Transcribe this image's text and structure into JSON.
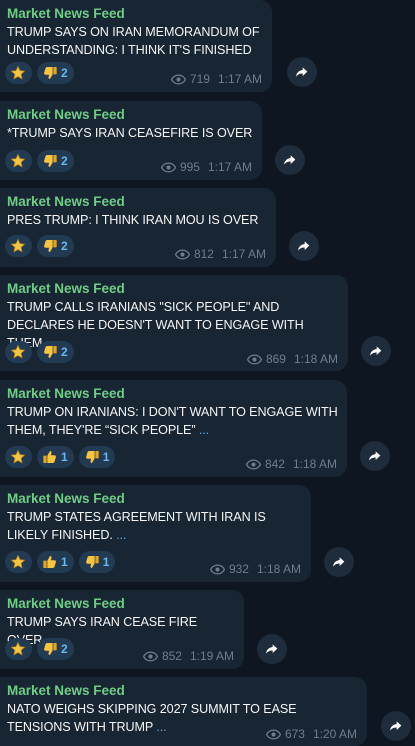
{
  "messages": [
    {
      "sender": "Market News Feed",
      "text": "TRUMP SAYS ON IRAN MEMORANDUM OF UNDERSTANDING: I THINK IT'S FINISHED",
      "more": "...",
      "reactions": [
        {
          "icon": "star-icon",
          "count": ""
        },
        {
          "icon": "thumbs-down-icon",
          "count": "2"
        }
      ],
      "views": "719",
      "time": "1:17 AM"
    },
    {
      "sender": "Market News Feed",
      "text": "*TRUMP SAYS IRAN CEASEFIRE IS OVER",
      "more": "...",
      "reactions": [
        {
          "icon": "star-icon",
          "count": ""
        },
        {
          "icon": "thumbs-down-icon",
          "count": "2"
        }
      ],
      "views": "995",
      "time": "1:17 AM"
    },
    {
      "sender": "Market News Feed",
      "text": "PRES TRUMP: I THINK IRAN MOU IS OVER",
      "more": "...",
      "reactions": [
        {
          "icon": "star-icon",
          "count": ""
        },
        {
          "icon": "thumbs-down-icon",
          "count": "2"
        }
      ],
      "views": "812",
      "time": "1:17 AM"
    },
    {
      "sender": "Market News Feed",
      "text": "TRUMP CALLS IRANIANS \"SICK PEOPLE\" AND DECLARES HE DOESN'T WANT TO ENGAGE WITH THEM.",
      "more": "...",
      "reactions": [
        {
          "icon": "star-icon",
          "count": ""
        },
        {
          "icon": "thumbs-down-icon",
          "count": "2"
        }
      ],
      "views": "869",
      "time": "1:18 AM"
    },
    {
      "sender": "Market News Feed",
      "text": "TRUMP ON IRANIANS: I DON'T WANT TO ENGAGE WITH THEM, THEY'RE “SICK PEOPLE”",
      "more": "...",
      "reactions": [
        {
          "icon": "star-icon",
          "count": ""
        },
        {
          "icon": "thumbs-up-icon",
          "count": "1"
        },
        {
          "icon": "thumbs-down-icon",
          "count": "1"
        }
      ],
      "views": "842",
      "time": "1:18 AM"
    },
    {
      "sender": "Market News Feed",
      "text": "TRUMP STATES AGREEMENT WITH IRAN IS LIKELY FINISHED.",
      "more": "...",
      "reactions": [
        {
          "icon": "star-icon",
          "count": ""
        },
        {
          "icon": "thumbs-up-icon",
          "count": "1"
        },
        {
          "icon": "thumbs-down-icon",
          "count": "1"
        }
      ],
      "views": "932",
      "time": "1:18 AM"
    },
    {
      "sender": "Market News Feed",
      "text": "TRUMP SAYS IRAN CEASE FIRE OVER",
      "more": "...",
      "reactions": [
        {
          "icon": "star-icon",
          "count": ""
        },
        {
          "icon": "thumbs-down-icon",
          "count": "2"
        }
      ],
      "views": "852",
      "time": "1:19 AM"
    },
    {
      "sender": "Market News Feed",
      "text": "NATO WEIGHS SKIPPING 2027 SUMMIT TO EASE TENSIONS WITH TRUMP",
      "more": "...",
      "reactions": [],
      "views": "673",
      "time": "1:20 AM"
    }
  ],
  "colors": {
    "background": "#0e1621",
    "bubble": "#182533",
    "sender": "#6fce86",
    "link": "#5fa8e3",
    "chip": "#223b52",
    "chip_text": "#6cb6ef",
    "meta": "#6d7f8f"
  }
}
